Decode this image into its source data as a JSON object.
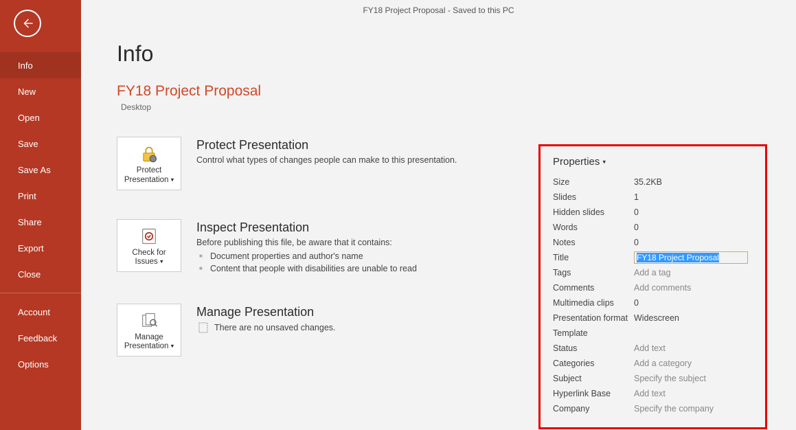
{
  "titleBar": "FY18 Project Proposal  -  Saved to this PC",
  "nav": {
    "items": [
      {
        "key": "info",
        "label": "Info",
        "active": true
      },
      {
        "key": "new",
        "label": "New"
      },
      {
        "key": "open",
        "label": "Open"
      },
      {
        "key": "save",
        "label": "Save"
      },
      {
        "key": "saveas",
        "label": "Save As"
      },
      {
        "key": "print",
        "label": "Print"
      },
      {
        "key": "share",
        "label": "Share"
      },
      {
        "key": "export",
        "label": "Export"
      },
      {
        "key": "close",
        "label": "Close"
      }
    ],
    "footer": [
      {
        "key": "account",
        "label": "Account"
      },
      {
        "key": "feedback",
        "label": "Feedback"
      },
      {
        "key": "options",
        "label": "Options"
      }
    ]
  },
  "page": {
    "title": "Info",
    "docTitle": "FY18 Project Proposal",
    "docPath": "Desktop"
  },
  "sections": {
    "protect": {
      "button": "Protect Presentation",
      "title": "Protect Presentation",
      "desc": "Control what types of changes people can make to this presentation."
    },
    "inspect": {
      "button": "Check for Issues",
      "title": "Inspect Presentation",
      "desc": "Before publishing this file, be aware that it contains:",
      "items": [
        "Document properties and author's name",
        "Content that people with disabilities are unable to read"
      ]
    },
    "manage": {
      "button": "Manage Presentation",
      "title": "Manage Presentation",
      "msg": "There are no unsaved changes."
    }
  },
  "props": {
    "header": "Properties",
    "rows": [
      {
        "label": "Size",
        "value": "35.2KB"
      },
      {
        "label": "Slides",
        "value": "1"
      },
      {
        "label": "Hidden slides",
        "value": "0"
      },
      {
        "label": "Words",
        "value": "0"
      },
      {
        "label": "Notes",
        "value": "0"
      }
    ],
    "title": {
      "label": "Title",
      "value": "FY18 Project Proposal"
    },
    "editRows": [
      {
        "label": "Tags",
        "placeholder": "Add a tag"
      },
      {
        "label": "Comments",
        "placeholder": "Add comments"
      }
    ],
    "more": [
      {
        "label": "Multimedia clips",
        "value": "0"
      },
      {
        "label": "Presentation format",
        "value": "Widescreen"
      },
      {
        "label": "Template",
        "value": ""
      }
    ],
    "editMore": [
      {
        "label": "Status",
        "placeholder": "Add text"
      },
      {
        "label": "Categories",
        "placeholder": "Add a category"
      },
      {
        "label": "Subject",
        "placeholder": "Specify the subject"
      },
      {
        "label": "Hyperlink Base",
        "placeholder": "Add text"
      },
      {
        "label": "Company",
        "placeholder": "Specify the company"
      }
    ]
  }
}
